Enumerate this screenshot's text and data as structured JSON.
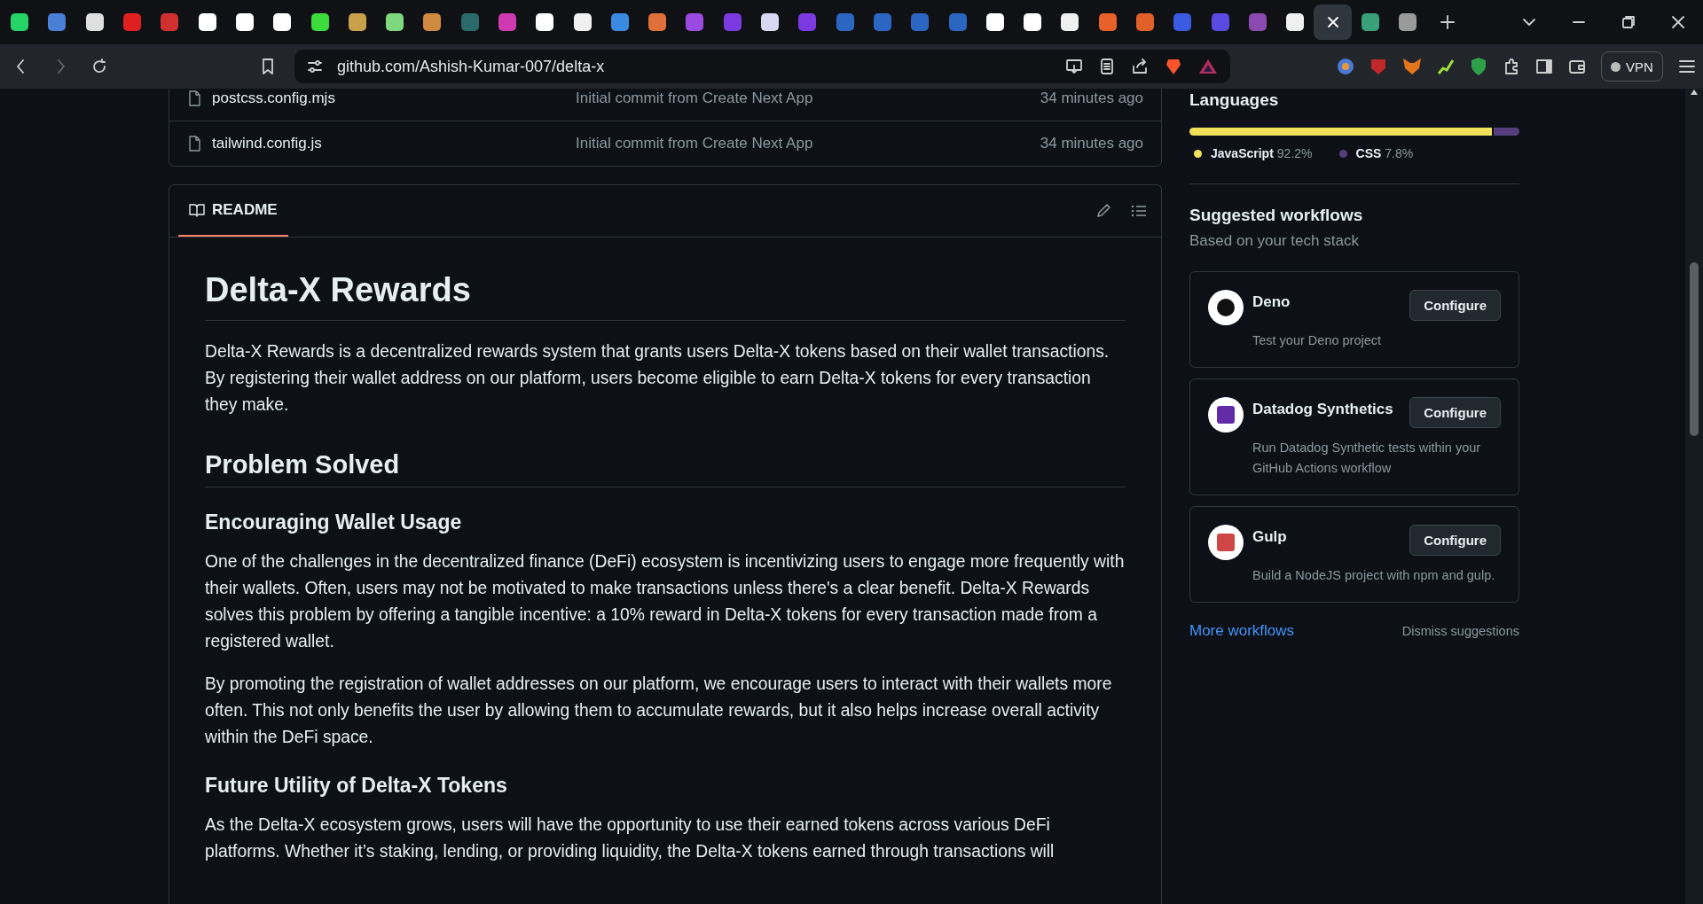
{
  "browser": {
    "tabs": [
      {
        "selected": false,
        "color": "#25d366"
      },
      {
        "selected": false,
        "color": "#4a7fd6"
      },
      {
        "selected": false,
        "color": "#e0e0e0"
      },
      {
        "selected": false,
        "color": "#e02020"
      },
      {
        "selected": false,
        "color": "#d03030"
      },
      {
        "selected": false,
        "color": "#ffffff"
      },
      {
        "selected": false,
        "color": "#ffffff"
      },
      {
        "selected": false,
        "color": "#ffffff"
      },
      {
        "selected": false,
        "color": "#3adb3a"
      },
      {
        "selected": false,
        "color": "#c8a14a"
      },
      {
        "selected": false,
        "color": "#7ed87e"
      },
      {
        "selected": false,
        "color": "#d08a40"
      },
      {
        "selected": false,
        "color": "#2a6a6a"
      },
      {
        "selected": false,
        "color": "#d03ab0"
      },
      {
        "selected": false,
        "color": "#ffffff"
      },
      {
        "selected": false,
        "color": "#f0f0f0"
      },
      {
        "selected": false,
        "color": "#3a8ae0"
      },
      {
        "selected": false,
        "color": "#e0703a"
      },
      {
        "selected": false,
        "color": "#9a4ae0"
      },
      {
        "selected": false,
        "color": "#7a3ae0"
      },
      {
        "selected": false,
        "color": "#d8d8f0"
      },
      {
        "selected": false,
        "color": "#7a3ae0"
      },
      {
        "selected": false,
        "color": "#2a66c2"
      },
      {
        "selected": false,
        "color": "#2a66c2"
      },
      {
        "selected": false,
        "color": "#2a66c2"
      },
      {
        "selected": false,
        "color": "#2a66c2"
      },
      {
        "selected": false,
        "color": "#ffffff"
      },
      {
        "selected": false,
        "color": "#ffffff"
      },
      {
        "selected": false,
        "color": "#f0f0f0"
      },
      {
        "selected": false,
        "color": "#e8602a"
      },
      {
        "selected": false,
        "color": "#e0602a"
      },
      {
        "selected": false,
        "color": "#3a5ae0"
      },
      {
        "selected": false,
        "color": "#5a4ae0"
      },
      {
        "selected": false,
        "color": "#8a4ab0"
      },
      {
        "selected": false,
        "color": "#f0f0f0"
      },
      {
        "selected": true
      },
      {
        "selected": false,
        "color": "#3aa07a"
      },
      {
        "selected": false,
        "color": "#9a9a9a"
      }
    ],
    "address": "github.com/Ashish-Kumar-007/delta-x",
    "vpn": "VPN"
  },
  "files": [
    {
      "name": "postcss.config.mjs",
      "message": "Initial commit from Create Next App",
      "time": "34 minutes ago"
    },
    {
      "name": "tailwind.config.js",
      "message": "Initial commit from Create Next App",
      "time": "34 minutes ago"
    }
  ],
  "readme": {
    "tab": "README",
    "blocks": [
      {
        "kind": "h1",
        "text": "Delta-X Rewards"
      },
      {
        "kind": "p",
        "text": "Delta-X Rewards is a decentralized rewards system that grants users Delta-X tokens based on their wallet transactions. By registering their wallet address on our platform, users become eligible to earn Delta-X tokens for every transaction they make."
      },
      {
        "kind": "h2",
        "text": "Problem Solved"
      },
      {
        "kind": "h3",
        "text": "Encouraging Wallet Usage"
      },
      {
        "kind": "p",
        "text": "One of the challenges in the decentralized finance (DeFi) ecosystem is incentivizing users to engage more frequently with their wallets. Often, users may not be motivated to make transactions unless there's a clear benefit. Delta-X Rewards solves this problem by offering a tangible incentive: a 10% reward in Delta-X tokens for every transaction made from a registered wallet."
      },
      {
        "kind": "p",
        "text": "By promoting the registration of wallet addresses on our platform, we encourage users to interact with their wallets more often. This not only benefits the user by allowing them to accumulate rewards, but it also helps increase overall activity within the DeFi space."
      },
      {
        "kind": "h3",
        "text": "Future Utility of Delta-X Tokens"
      },
      {
        "kind": "p",
        "text": "As the Delta-X ecosystem grows, users will have the opportunity to use their earned tokens across various DeFi platforms. Whether it’s staking, lending, or providing liquidity, the Delta-X tokens earned through transactions will"
      }
    ]
  },
  "sidebar": {
    "languages": {
      "title": "Languages",
      "items": [
        {
          "name": "JavaScript",
          "percent": "92.2%",
          "level": 0.922,
          "color": "#f1e05a"
        },
        {
          "name": "CSS",
          "percent": "7.8%",
          "level": 0.078,
          "color": "#563d7c"
        }
      ]
    },
    "workflows": {
      "title": "Suggested workflows",
      "subtitle": "Based on your tech stack",
      "items": [
        {
          "name": "Deno",
          "description": "Test your Deno project",
          "button": "Configure",
          "color": "#111111"
        },
        {
          "name": "Datadog Synthetics",
          "description": "Run Datadog Synthetic tests within your GitHub Actions workflow",
          "button": "Configure",
          "color": "#632ca6"
        },
        {
          "name": "Gulp",
          "description": "Build a NodeJS project with npm and gulp.",
          "button": "Configure",
          "color": "#cf4647"
        }
      ],
      "more": "More workflows",
      "dismiss": "Dismiss suggestions"
    }
  }
}
